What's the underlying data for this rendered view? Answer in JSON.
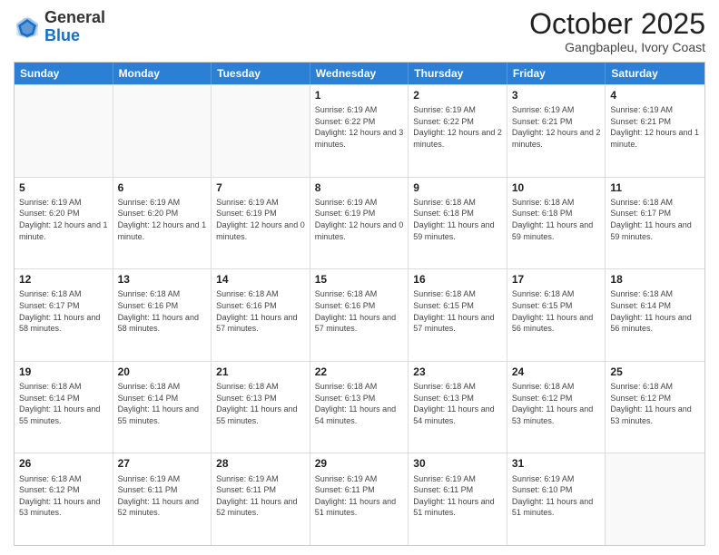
{
  "logo": {
    "general": "General",
    "blue": "Blue"
  },
  "header": {
    "month": "October 2025",
    "location": "Gangbapleu, Ivory Coast"
  },
  "weekdays": [
    "Sunday",
    "Monday",
    "Tuesday",
    "Wednesday",
    "Thursday",
    "Friday",
    "Saturday"
  ],
  "rows": [
    [
      {
        "day": "",
        "info": ""
      },
      {
        "day": "",
        "info": ""
      },
      {
        "day": "",
        "info": ""
      },
      {
        "day": "1",
        "info": "Sunrise: 6:19 AM\nSunset: 6:22 PM\nDaylight: 12 hours and 3 minutes."
      },
      {
        "day": "2",
        "info": "Sunrise: 6:19 AM\nSunset: 6:22 PM\nDaylight: 12 hours and 2 minutes."
      },
      {
        "day": "3",
        "info": "Sunrise: 6:19 AM\nSunset: 6:21 PM\nDaylight: 12 hours and 2 minutes."
      },
      {
        "day": "4",
        "info": "Sunrise: 6:19 AM\nSunset: 6:21 PM\nDaylight: 12 hours and 1 minute."
      }
    ],
    [
      {
        "day": "5",
        "info": "Sunrise: 6:19 AM\nSunset: 6:20 PM\nDaylight: 12 hours and 1 minute."
      },
      {
        "day": "6",
        "info": "Sunrise: 6:19 AM\nSunset: 6:20 PM\nDaylight: 12 hours and 1 minute."
      },
      {
        "day": "7",
        "info": "Sunrise: 6:19 AM\nSunset: 6:19 PM\nDaylight: 12 hours and 0 minutes."
      },
      {
        "day": "8",
        "info": "Sunrise: 6:19 AM\nSunset: 6:19 PM\nDaylight: 12 hours and 0 minutes."
      },
      {
        "day": "9",
        "info": "Sunrise: 6:18 AM\nSunset: 6:18 PM\nDaylight: 11 hours and 59 minutes."
      },
      {
        "day": "10",
        "info": "Sunrise: 6:18 AM\nSunset: 6:18 PM\nDaylight: 11 hours and 59 minutes."
      },
      {
        "day": "11",
        "info": "Sunrise: 6:18 AM\nSunset: 6:17 PM\nDaylight: 11 hours and 59 minutes."
      }
    ],
    [
      {
        "day": "12",
        "info": "Sunrise: 6:18 AM\nSunset: 6:17 PM\nDaylight: 11 hours and 58 minutes."
      },
      {
        "day": "13",
        "info": "Sunrise: 6:18 AM\nSunset: 6:16 PM\nDaylight: 11 hours and 58 minutes."
      },
      {
        "day": "14",
        "info": "Sunrise: 6:18 AM\nSunset: 6:16 PM\nDaylight: 11 hours and 57 minutes."
      },
      {
        "day": "15",
        "info": "Sunrise: 6:18 AM\nSunset: 6:16 PM\nDaylight: 11 hours and 57 minutes."
      },
      {
        "day": "16",
        "info": "Sunrise: 6:18 AM\nSunset: 6:15 PM\nDaylight: 11 hours and 57 minutes."
      },
      {
        "day": "17",
        "info": "Sunrise: 6:18 AM\nSunset: 6:15 PM\nDaylight: 11 hours and 56 minutes."
      },
      {
        "day": "18",
        "info": "Sunrise: 6:18 AM\nSunset: 6:14 PM\nDaylight: 11 hours and 56 minutes."
      }
    ],
    [
      {
        "day": "19",
        "info": "Sunrise: 6:18 AM\nSunset: 6:14 PM\nDaylight: 11 hours and 55 minutes."
      },
      {
        "day": "20",
        "info": "Sunrise: 6:18 AM\nSunset: 6:14 PM\nDaylight: 11 hours and 55 minutes."
      },
      {
        "day": "21",
        "info": "Sunrise: 6:18 AM\nSunset: 6:13 PM\nDaylight: 11 hours and 55 minutes."
      },
      {
        "day": "22",
        "info": "Sunrise: 6:18 AM\nSunset: 6:13 PM\nDaylight: 11 hours and 54 minutes."
      },
      {
        "day": "23",
        "info": "Sunrise: 6:18 AM\nSunset: 6:13 PM\nDaylight: 11 hours and 54 minutes."
      },
      {
        "day": "24",
        "info": "Sunrise: 6:18 AM\nSunset: 6:12 PM\nDaylight: 11 hours and 53 minutes."
      },
      {
        "day": "25",
        "info": "Sunrise: 6:18 AM\nSunset: 6:12 PM\nDaylight: 11 hours and 53 minutes."
      }
    ],
    [
      {
        "day": "26",
        "info": "Sunrise: 6:18 AM\nSunset: 6:12 PM\nDaylight: 11 hours and 53 minutes."
      },
      {
        "day": "27",
        "info": "Sunrise: 6:19 AM\nSunset: 6:11 PM\nDaylight: 11 hours and 52 minutes."
      },
      {
        "day": "28",
        "info": "Sunrise: 6:19 AM\nSunset: 6:11 PM\nDaylight: 11 hours and 52 minutes."
      },
      {
        "day": "29",
        "info": "Sunrise: 6:19 AM\nSunset: 6:11 PM\nDaylight: 11 hours and 51 minutes."
      },
      {
        "day": "30",
        "info": "Sunrise: 6:19 AM\nSunset: 6:11 PM\nDaylight: 11 hours and 51 minutes."
      },
      {
        "day": "31",
        "info": "Sunrise: 6:19 AM\nSunset: 6:10 PM\nDaylight: 11 hours and 51 minutes."
      },
      {
        "day": "",
        "info": ""
      }
    ]
  ]
}
